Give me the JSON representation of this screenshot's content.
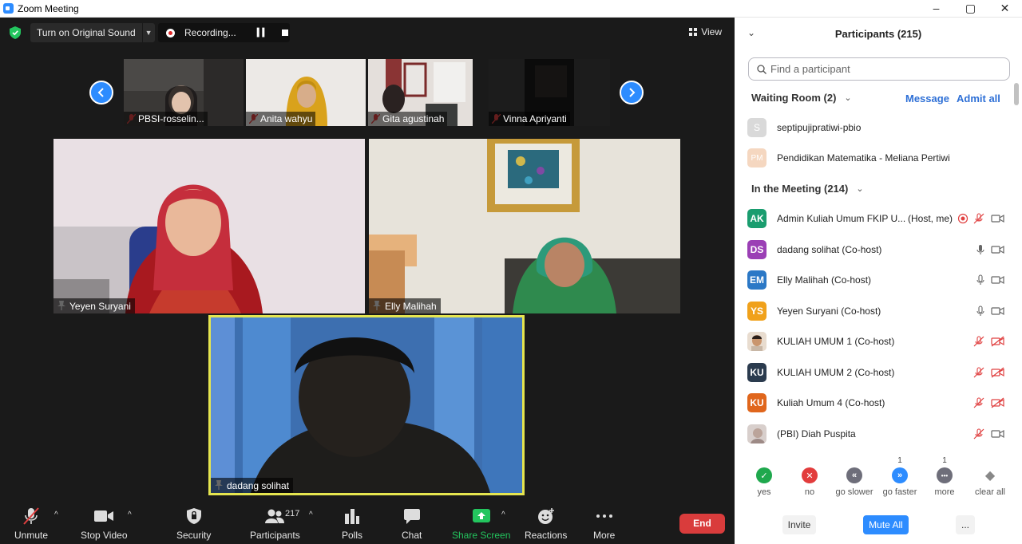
{
  "window": {
    "title": "Zoom Meeting",
    "controls": [
      "–",
      "▢",
      "✕"
    ]
  },
  "topbar": {
    "original_sound_label": "Turn on Original Sound",
    "recording_label": "Recording...",
    "view_label": "View"
  },
  "thumbnails": [
    {
      "name": "PBSI-rosselin..."
    },
    {
      "name": "Anita wahyu"
    },
    {
      "name": "Gita agustinah"
    },
    {
      "name": "Vinna Apriyanti"
    }
  ],
  "main_tiles": [
    {
      "name": "Yeyen Suryani"
    },
    {
      "name": "Elly Malihah"
    },
    {
      "name": "dadang solihat",
      "active_speaker": true
    }
  ],
  "toolbar": {
    "unmute": "Unmute",
    "stop_video": "Stop Video",
    "security": "Security",
    "participants": "Participants",
    "participants_count": "217",
    "polls": "Polls",
    "chat": "Chat",
    "share_screen": "Share Screen",
    "reactions": "Reactions",
    "more": "More",
    "end": "End"
  },
  "panel": {
    "title": "Participants (215)",
    "search_placeholder": "Find a participant",
    "waiting_room": {
      "header": "Waiting Room (2)",
      "message": "Message",
      "admit_all": "Admit all",
      "people": [
        {
          "initials": "S",
          "name": "septipujipratiwi-pbio",
          "color": "#d9d9d9"
        },
        {
          "initials": "PM",
          "name": "Pendidikan Matematika - Meliana Pertiwi",
          "color": "#f5d7c0"
        }
      ]
    },
    "in_meeting": {
      "header": "In the Meeting (214)",
      "people": [
        {
          "initials": "AK",
          "name": "Admin Kuliah Umum FKIP U...",
          "role": "(Host, me)",
          "color": "#1a9d6f",
          "mic": "muted",
          "cam": "on",
          "recording": true
        },
        {
          "initials": "DS",
          "name": "dadang solihat (Co-host)",
          "color": "#9b3fb5",
          "mic": "on-active",
          "cam": "on"
        },
        {
          "initials": "EM",
          "name": "Elly Malihah (Co-host)",
          "color": "#2b78c6",
          "mic": "on",
          "cam": "on"
        },
        {
          "initials": "YS",
          "name": "Yeyen Suryani (Co-host)",
          "color": "#f0a11b",
          "mic": "on",
          "cam": "on"
        },
        {
          "initials": "",
          "name": "KULIAH UMUM 1 (Co-host)",
          "color": "#c9a27e",
          "mic": "muted",
          "cam": "off"
        },
        {
          "initials": "KU",
          "name": "KULIAH UMUM 2 (Co-host)",
          "color": "#2b3b4e",
          "mic": "muted",
          "cam": "off"
        },
        {
          "initials": "KU",
          "name": "Kuliah Umum 4 (Co-host)",
          "color": "#e0661c",
          "mic": "muted",
          "cam": "off"
        },
        {
          "initials": "",
          "name": "(PBI) Diah Puspita",
          "color": "#cfc6c4",
          "mic": "muted",
          "cam": "on"
        }
      ]
    },
    "reactions": [
      {
        "label": "yes",
        "count": "",
        "color": "#1fa84d",
        "glyph": "✓"
      },
      {
        "label": "no",
        "count": "",
        "color": "#e23c3c",
        "glyph": "✕"
      },
      {
        "label": "go slower",
        "count": "",
        "color": "#6e6e7a",
        "glyph": "«"
      },
      {
        "label": "go faster",
        "count": "1",
        "color": "#2d8cff",
        "glyph": "»"
      },
      {
        "label": "more",
        "count": "1",
        "color": "#6e6e7a",
        "glyph": "•••"
      },
      {
        "label": "clear all",
        "count": "",
        "color": "#888888",
        "glyph": "◆"
      }
    ],
    "buttons": {
      "invite": "Invite",
      "mute_all": "Mute All",
      "more": "..."
    }
  }
}
